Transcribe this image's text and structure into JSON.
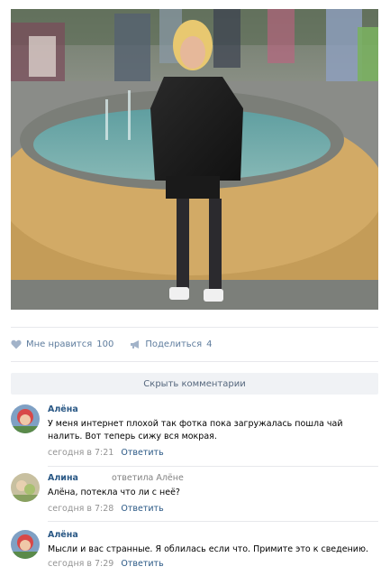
{
  "post": {
    "like_label": "Мне нравится",
    "like_count": "100",
    "share_label": "Поделиться",
    "share_count": "4"
  },
  "comments_bar": {
    "hide_label": "Скрыть комментарии"
  },
  "comments": [
    {
      "author": "Алёна",
      "reply_to": "",
      "text": "У меня интернет плохой так фотка пока загружалась пошла чай налить. Вот теперь сижу вся мокрая.",
      "time": "сегодня в 7:21",
      "reply_label": "Ответить"
    },
    {
      "author": "Алина",
      "reply_to": "ответила Алёне",
      "text": "Алёна, потекла что ли с неё?",
      "time": "сегодня в 7:28",
      "reply_label": "Ответить"
    },
    {
      "author": "Алёна",
      "reply_to": "",
      "text": "Мысли и вас странные. Я облилась если что. Примите это к сведению.",
      "time": "сегодня в 7:29",
      "reply_label": "Ответить"
    }
  ],
  "icons": {
    "like": "heart-icon",
    "share": "megaphone-icon"
  },
  "colors": {
    "link": "#2a5885",
    "action": "#5e7c9d",
    "meta": "#939393",
    "bar_bg": "#f0f2f5"
  }
}
